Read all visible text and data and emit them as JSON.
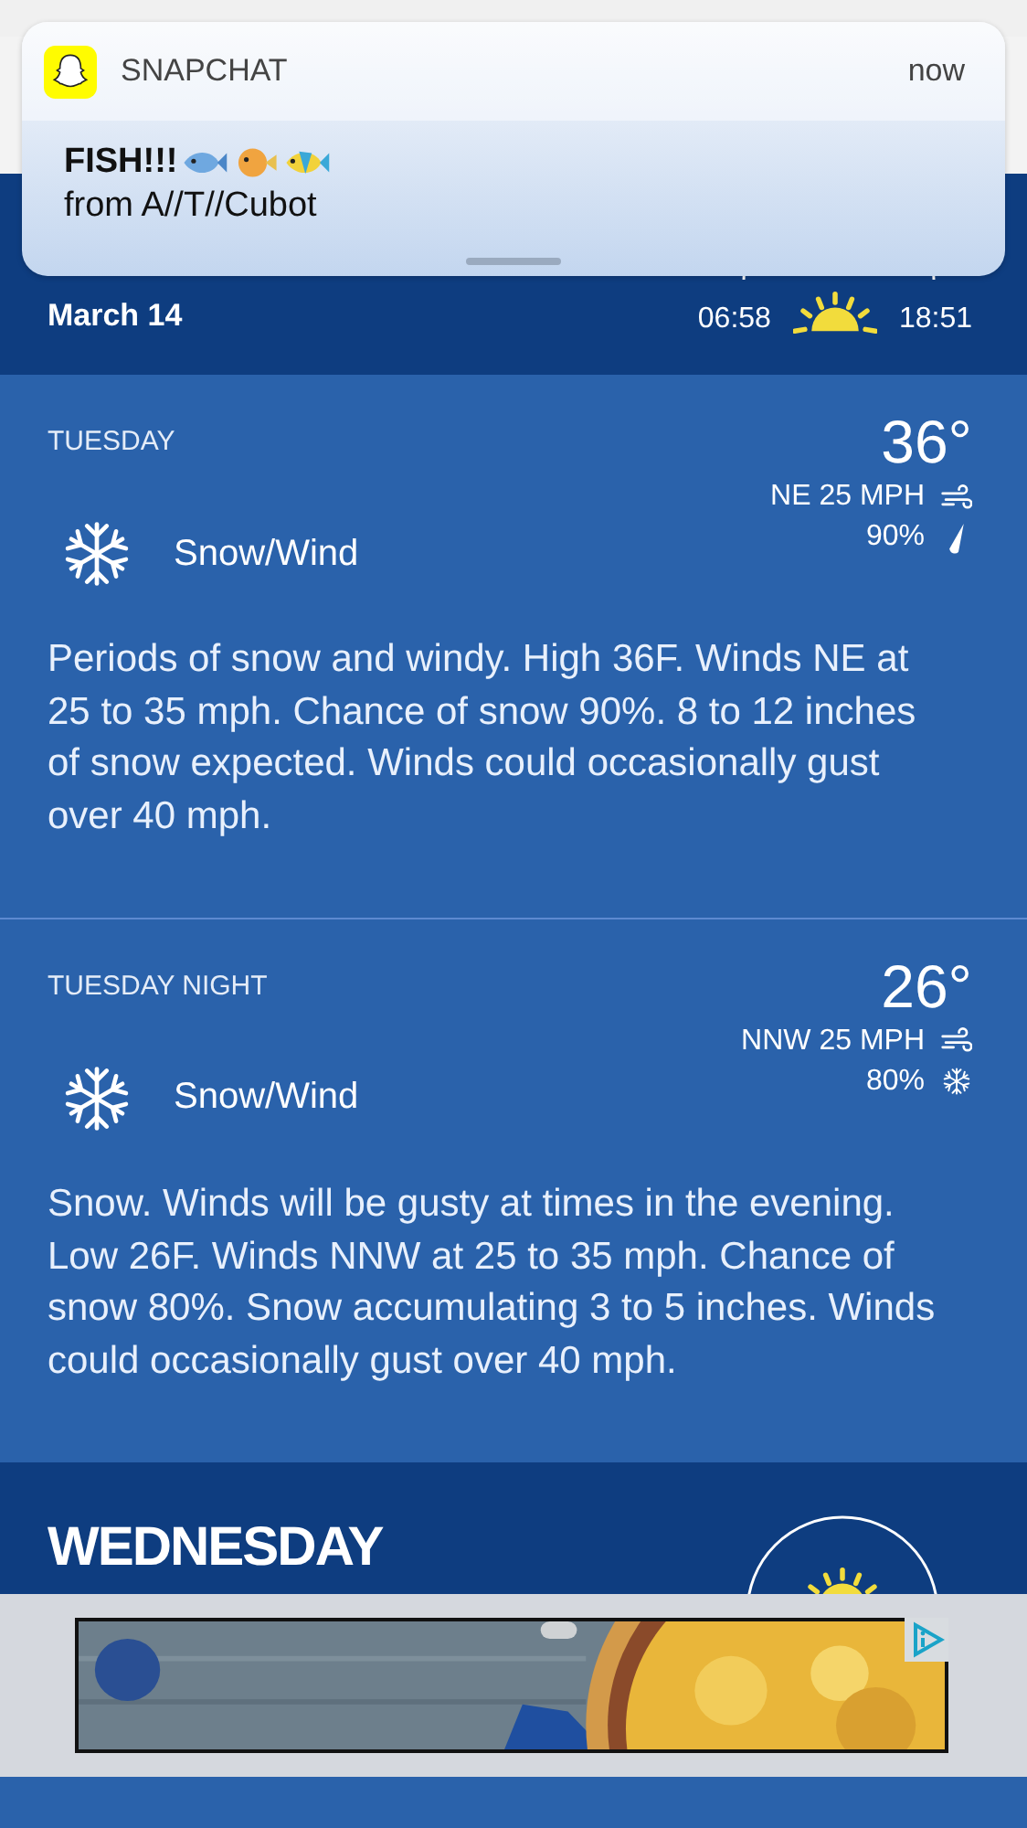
{
  "notification": {
    "app": "SNAPCHAT",
    "time": "now",
    "title": "FISH!!!",
    "body": "from A//T//Cubot"
  },
  "header": {
    "date": "March 14",
    "sunrise": "06:58",
    "sunset": "18:51"
  },
  "periods": [
    {
      "label": "TUESDAY",
      "temp": "36°",
      "wind": "NE 25 MPH",
      "precip": "90%",
      "kind": "rain",
      "condition": "Snow/Wind",
      "description": "Periods of snow and windy. High 36F. Winds NE at 25 to 35 mph. Chance of snow 90%. 8 to 12 inches of snow expected. Winds could occasionally gust over 40 mph."
    },
    {
      "label": "TUESDAY NIGHT",
      "temp": "26°",
      "wind": "NNW 25 MPH",
      "precip": "80%",
      "kind": "snow",
      "condition": "Snow/Wind",
      "description": "Snow. Winds will be gusty at times in the evening. Low 26F. Winds NNW at 25 to 35 mph. Chance of snow 80%. Snow accumulating 3 to 5 inches. Winds could occasionally gust over 40 mph."
    }
  ],
  "next_day": {
    "day": "WEDNESDAY"
  }
}
